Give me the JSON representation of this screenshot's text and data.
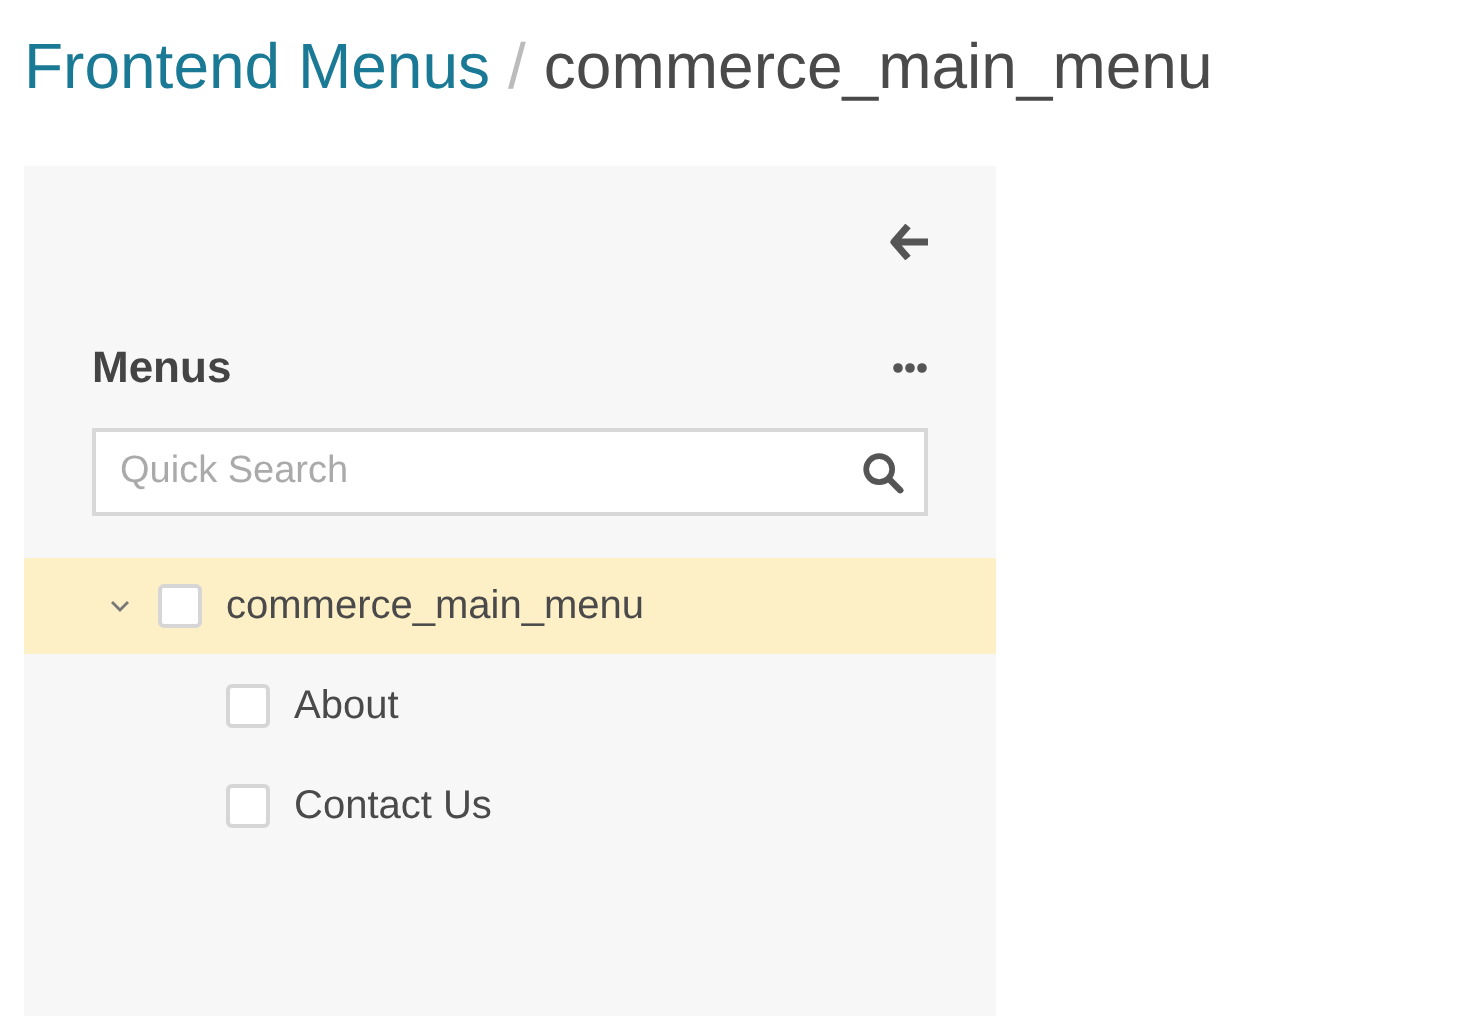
{
  "breadcrumb": {
    "link": "Frontend Menus",
    "separator": "/",
    "current": "commerce_main_menu"
  },
  "panel": {
    "heading": "Menus",
    "search": {
      "placeholder": "Quick Search"
    },
    "tree": [
      {
        "label": "commerce_main_menu",
        "expanded": true,
        "selected": true,
        "checked": false,
        "children": [
          {
            "label": "About",
            "selected": false,
            "checked": false
          },
          {
            "label": "Contact Us",
            "selected": false,
            "checked": false
          }
        ]
      }
    ]
  }
}
